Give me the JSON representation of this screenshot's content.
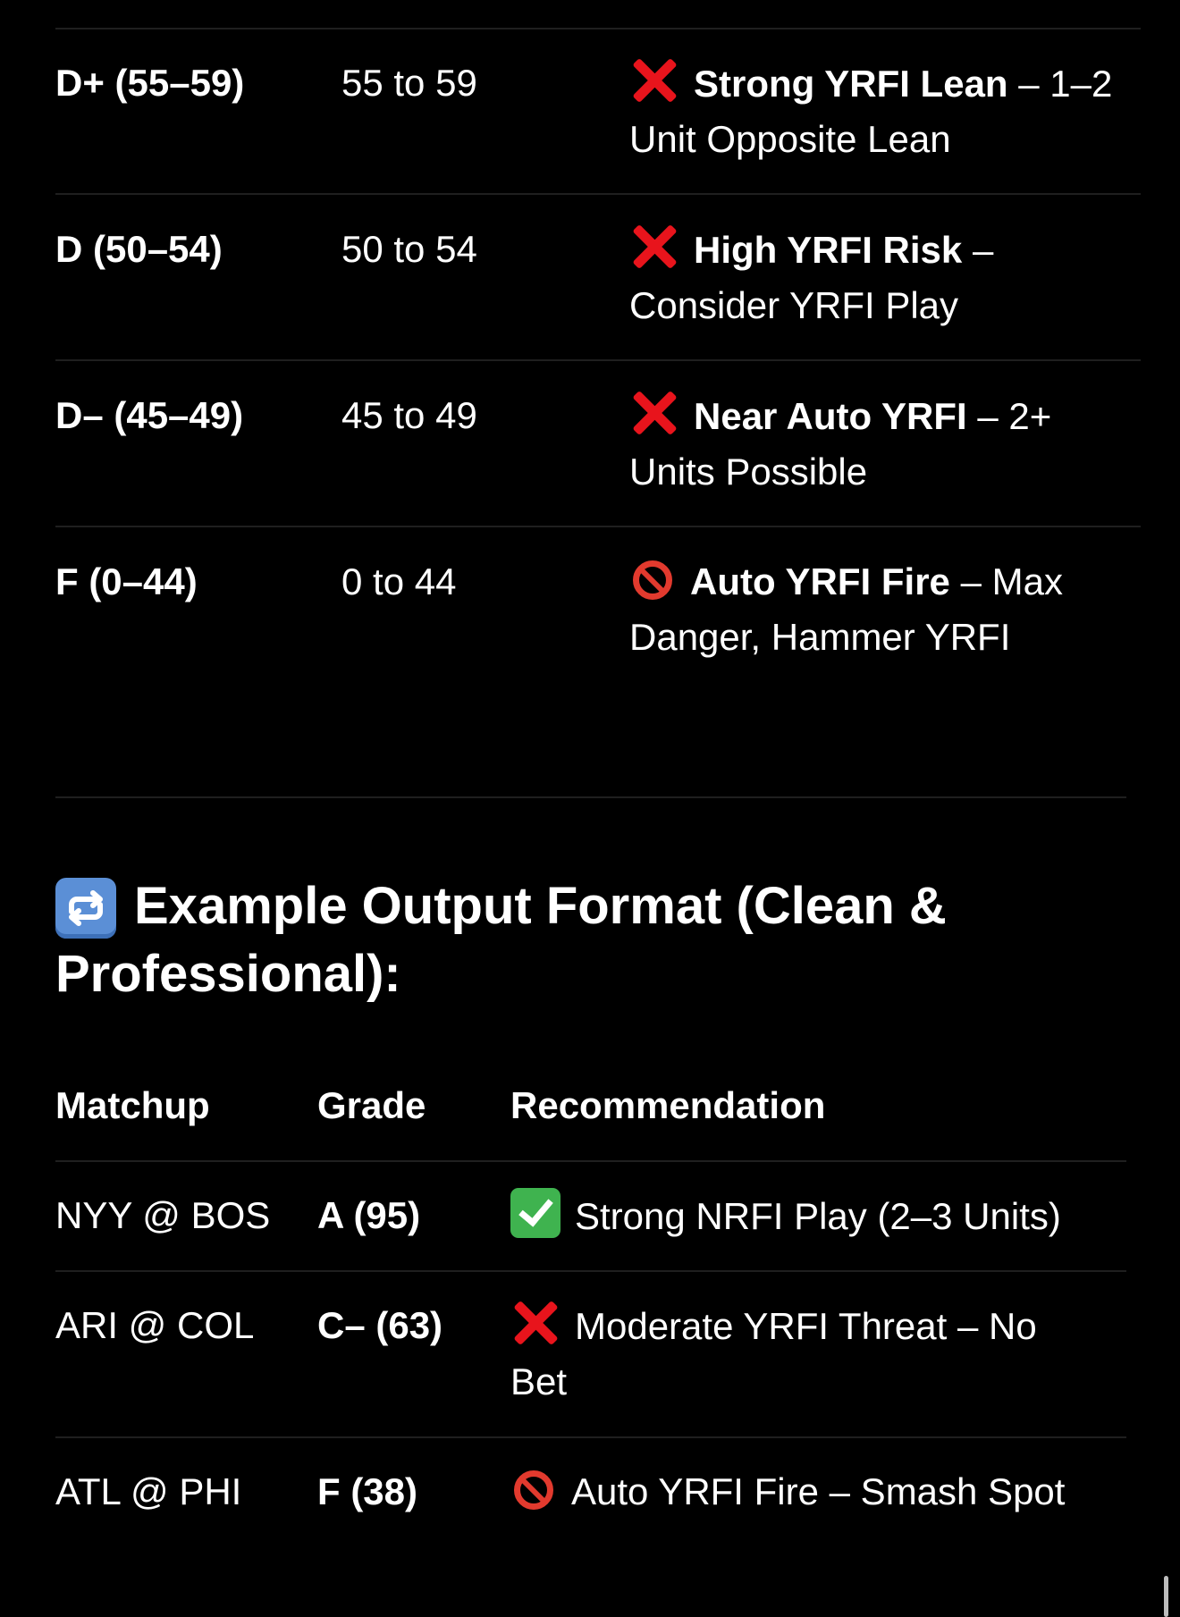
{
  "grade_rows": [
    {
      "grade": "D+ (55–59)",
      "range": "55 to 59",
      "icon": "cross-mark-icon",
      "bold": "Strong YRFI Lean",
      "rest": " – 1–2 Unit Opposite Lean"
    },
    {
      "grade": "D (50–54)",
      "range": "50 to 54",
      "icon": "cross-mark-icon",
      "bold": "High YRFI Risk",
      "rest": " – Consider YRFI Play"
    },
    {
      "grade": "D– (45–49)",
      "range": "45 to 49",
      "icon": "cross-mark-icon",
      "bold": "Near Auto YRFI",
      "rest": " – 2+ Units Possible"
    },
    {
      "grade": "F (0–44)",
      "range": "0 to 44",
      "icon": "no-entry-icon",
      "bold": "Auto YRFI Fire",
      "rest": " – Max Danger, Hammer YRFI"
    }
  ],
  "section": {
    "icon": "repeat-arrows-icon",
    "title": "Example Output Format (Clean & Professional):"
  },
  "example_table": {
    "headers": [
      "Matchup",
      "Grade",
      "Recommendation"
    ],
    "rows": [
      {
        "matchup": "NYY @ BOS",
        "grade": "A (95)",
        "icon": "check-mark-icon",
        "recommendation": "Strong NRFI Play (2–3 Units)"
      },
      {
        "matchup": "ARI @ COL",
        "grade": "C– (63)",
        "icon": "cross-mark-icon",
        "recommendation": "Moderate YRFI Threat – No Bet"
      },
      {
        "matchup": "ATL @ PHI",
        "grade": "F (38)",
        "icon": "no-entry-icon",
        "recommendation": "Auto YRFI Fire – Smash Spot"
      }
    ]
  },
  "colors": {
    "background": "#000000",
    "text": "#ffffff",
    "cross": "#e8141c",
    "check": "#3fb34f",
    "divider": "#1f1f1f"
  }
}
